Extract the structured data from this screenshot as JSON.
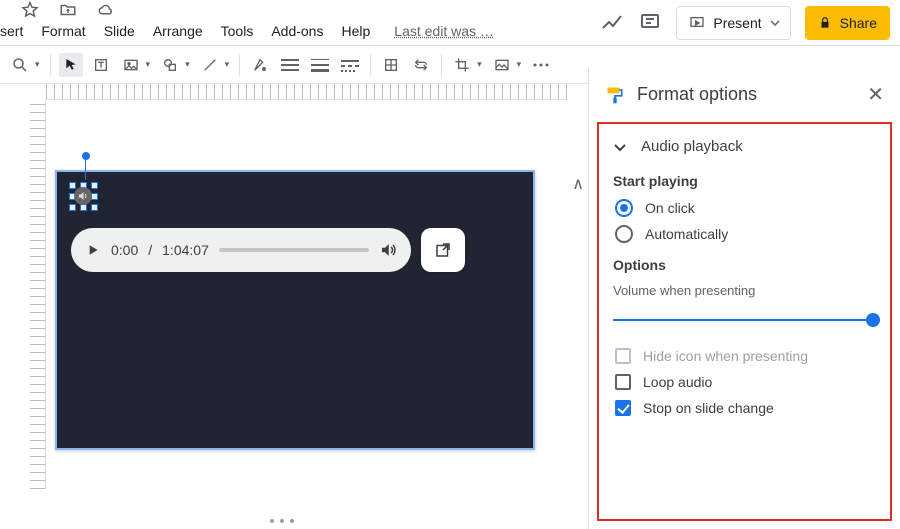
{
  "header": {
    "menu": [
      "sert",
      "Format",
      "Slide",
      "Arrange",
      "Tools",
      "Add-ons",
      "Help"
    ],
    "last_edit": "Last edit was …",
    "present_label": "Present",
    "share_label": "Share"
  },
  "audio_player": {
    "current_time": "0:00",
    "duration": "1:04:07"
  },
  "panel": {
    "title": "Format options",
    "section": "Audio playback",
    "start_playing_label": "Start playing",
    "radio_on_click": "On click",
    "radio_auto": "Automatically",
    "radio_selected": "on_click",
    "options_label": "Options",
    "volume_label": "Volume when presenting",
    "volume_value": 100,
    "checkbox_hide": "Hide icon when presenting",
    "checkbox_loop": "Loop audio",
    "checkbox_stop": "Stop on slide change",
    "hide_checked": false,
    "loop_checked": false,
    "stop_checked": true
  }
}
